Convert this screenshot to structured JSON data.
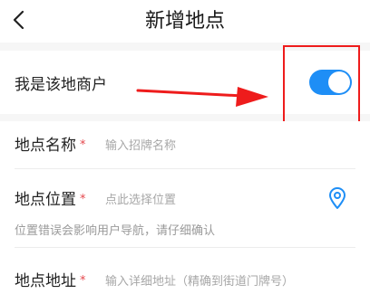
{
  "header": {
    "title": "新增地点",
    "back_icon": "chevron-left-icon"
  },
  "merchant_toggle": {
    "label": "我是该地商户",
    "enabled": true,
    "accent": "#1e8ef6"
  },
  "annotation": {
    "color": "#ee1c1c"
  },
  "form": {
    "required_mark": "*",
    "name": {
      "label": "地点名称",
      "placeholder": "输入招牌名称"
    },
    "position": {
      "label": "地点位置",
      "placeholder": "点此选择位置",
      "hint": "位置错误会影响用户导航，请仔细确认",
      "icon": "location-pin-icon"
    },
    "address": {
      "label": "地点地址",
      "placeholder": "输入详细地址（精确到街道门牌号）"
    }
  }
}
